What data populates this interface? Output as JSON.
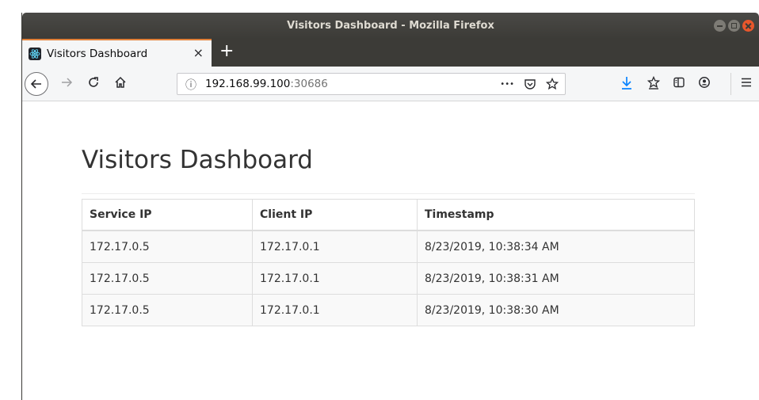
{
  "window": {
    "title": "Visitors Dashboard - Mozilla Firefox"
  },
  "tab": {
    "label": "Visitors Dashboard",
    "close": "×",
    "new_tab": "+"
  },
  "urlbar": {
    "host": "192.168.99.100",
    "port": ":30686",
    "info_glyph": "ⓘ",
    "more_glyph": "•••"
  },
  "page": {
    "title": "Visitors Dashboard",
    "table": {
      "headers": [
        "Service IP",
        "Client IP",
        "Timestamp"
      ],
      "rows": [
        [
          "172.17.0.5",
          "172.17.0.1",
          "8/23/2019, 10:38:34 AM"
        ],
        [
          "172.17.0.5",
          "172.17.0.1",
          "8/23/2019, 10:38:31 AM"
        ],
        [
          "172.17.0.5",
          "172.17.0.1",
          "8/23/2019, 10:38:30 AM"
        ]
      ]
    }
  },
  "colors": {
    "titlebar": "#3c3b37",
    "tab_accent": "#e2813a",
    "download_accent": "#0a84ff",
    "close_button": "#e8572c"
  }
}
